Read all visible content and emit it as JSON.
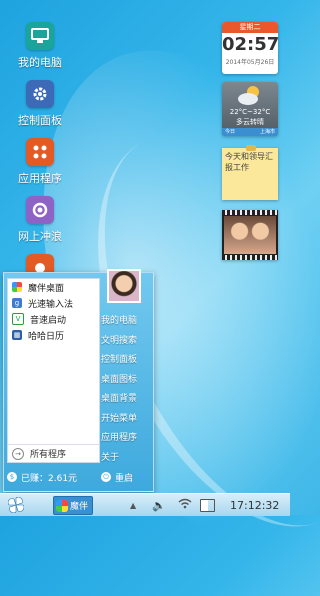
{
  "desktop": {
    "icons": [
      {
        "label": "我的电脑",
        "icon": "monitor-icon",
        "color": "#19a59a"
      },
      {
        "label": "控制面板",
        "icon": "gear-icon",
        "color": "#3d6ab6"
      },
      {
        "label": "应用程序",
        "icon": "apps-icon",
        "color": "#e35a25"
      },
      {
        "label": "网上冲浪",
        "icon": "browser-icon",
        "color": "#8e63c6"
      },
      {
        "label": "",
        "icon": "partial-icon",
        "color": "#e35a25"
      }
    ]
  },
  "widgets": {
    "clock": {
      "day": "星期二",
      "time": "02:57",
      "date": "2014年05月26日"
    },
    "weather": {
      "temp": "22°C~32°C",
      "desc": "多云转晴",
      "left": "今日",
      "right": "上海市"
    },
    "note": {
      "text": "今天和领导汇报工作"
    }
  },
  "start_menu": {
    "apps": [
      {
        "label": "魔伴桌面",
        "icon": "pinwheel-icon"
      },
      {
        "label": "光速输入法",
        "icon": "keyboard-icon"
      },
      {
        "label": "音速启动",
        "icon": "rocket-v-icon"
      },
      {
        "label": "哈哈日历",
        "icon": "calendar-icon"
      }
    ],
    "all_programs": "所有程序",
    "links": [
      "我的电脑",
      "文明搜索",
      "控制面板",
      "桌面图标",
      "桌面背景",
      "开始菜单",
      "应用程序",
      "关于"
    ],
    "used": "已赚：2.61元",
    "restart": "重启"
  },
  "taskbar": {
    "task_label": "魔伴",
    "time": "17:12:32"
  }
}
